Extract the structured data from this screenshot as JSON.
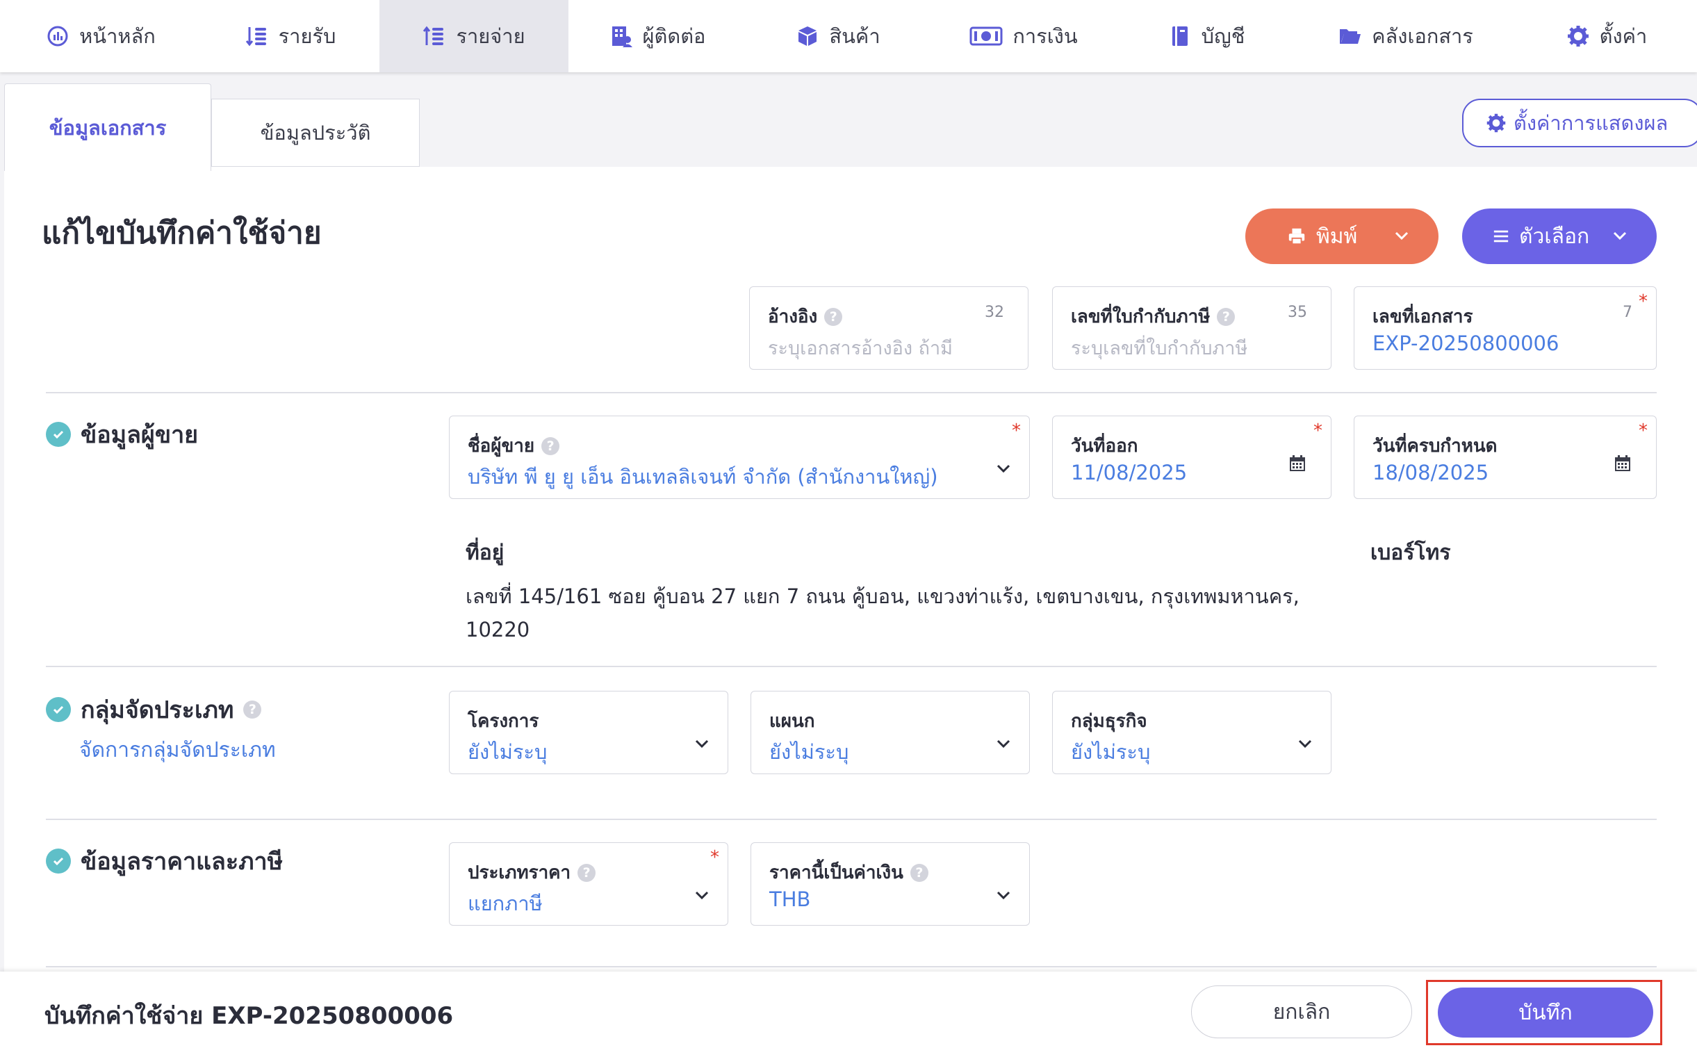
{
  "nav": {
    "items": [
      {
        "label": "หน้าหลัก",
        "icon": "dashboard-icon"
      },
      {
        "label": "รายรับ",
        "icon": "sort-income-icon"
      },
      {
        "label": "รายจ่าย",
        "icon": "sort-expense-icon"
      },
      {
        "label": "ผู้ติดต่อ",
        "icon": "contacts-icon"
      },
      {
        "label": "สินค้า",
        "icon": "box-icon"
      },
      {
        "label": "การเงิน",
        "icon": "money-icon"
      },
      {
        "label": "บัญชี",
        "icon": "book-icon"
      },
      {
        "label": "คลังเอกสาร",
        "icon": "folder-icon"
      },
      {
        "label": "ตั้งค่า",
        "icon": "gear-icon"
      }
    ],
    "active_index": 2
  },
  "tabs": {
    "main": "ข้อมูลเอกสาร",
    "history": "ข้อมูลประวัติ"
  },
  "display_settings_label": "ตั้งค่าการแสดงผล",
  "page_title": "แก้ไขบันทึกค่าใช้จ่าย",
  "actions": {
    "print_label": "พิมพ์",
    "options_label": "ตัวเลือก"
  },
  "doc_fields": {
    "reference": {
      "label": "อ้างอิง",
      "placeholder": "ระบุเอกสารอ้างอิง ถ้ามี",
      "count": "32"
    },
    "tax_invoice": {
      "label": "เลขที่ใบกำกับภาษี",
      "placeholder": "ระบุเลขที่ใบกำกับภาษี",
      "count": "35"
    },
    "doc_number": {
      "label": "เลขที่เอกสาร",
      "value": "EXP-20250800006",
      "count": "7",
      "required": "*"
    }
  },
  "seller": {
    "section_title": "ข้อมูลผู้ขาย",
    "name_label": "ชื่อผู้ขาย",
    "name_value": "บริษัท พี ยู ยู เอ็น อินเทลลิเจนท์ จำกัด (สำนักงานใหญ่)",
    "issue_date_label": "วันที่ออก",
    "issue_date_value": "11/08/2025",
    "due_date_label": "วันที่ครบกำหนด",
    "due_date_value": "18/08/2025",
    "address_label": "ที่อยู่",
    "address_value": "เลขที่ 145/161 ซอย คู้บอน 27 แยก 7 ถนน คู้บอน, แขวงท่าแร้ง, เขตบางเขน, กรุงเทพมหานคร, 10220",
    "phone_label": "เบอร์โทร",
    "required": "*"
  },
  "classification": {
    "section_title": "กลุ่มจัดประเภท",
    "manage_link": "จัดการกลุ่มจัดประเภท",
    "project_label": "โครงการ",
    "project_value": "ยังไม่ระบุ",
    "department_label": "แผนก",
    "department_value": "ยังไม่ระบุ",
    "business_group_label": "กลุ่มธุรกิจ",
    "business_group_value": "ยังไม่ระบุ"
  },
  "pricing": {
    "section_title": "ข้อมูลราคาและภาษี",
    "price_type_label": "ประเภทราคา",
    "price_type_value": "แยกภาษี",
    "currency_label": "ราคานี้เป็นค่าเงิน",
    "currency_value": "THB",
    "required": "*"
  },
  "footer": {
    "title": "บันทึกค่าใช้จ่าย EXP-20250800006",
    "cancel_label": "ยกเลิก",
    "save_label": "บันทึก"
  },
  "colors": {
    "accent": "#6b63e6",
    "print": "#ec7658",
    "link": "#4a7de0",
    "check": "#5fbfc8",
    "required": "#e0392b"
  }
}
